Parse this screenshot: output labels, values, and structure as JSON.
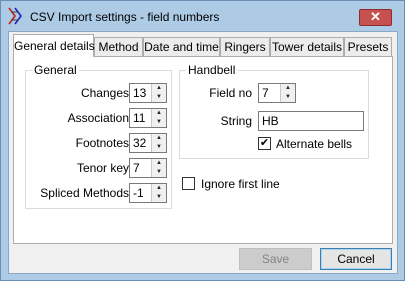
{
  "window": {
    "title": "CSV Import settings - field numbers",
    "close_glyph": "✕",
    "app_icon": "csv-app-icon",
    "accent": "#aecbe6"
  },
  "tabs": [
    {
      "label": "General details",
      "active": true
    },
    {
      "label": "Method"
    },
    {
      "label": "Date and time"
    },
    {
      "label": "Ringers"
    },
    {
      "label": "Tower details"
    },
    {
      "label": "Presets"
    }
  ],
  "general": {
    "title": "General",
    "changes": {
      "label": "Changes",
      "value": "13"
    },
    "association": {
      "label": "Association",
      "value": "11"
    },
    "footnotes": {
      "label": "Footnotes",
      "value": "32"
    },
    "tenor_key": {
      "label": "Tenor key",
      "value": "7"
    },
    "spliced_methods": {
      "label": "Spliced Methods",
      "value": "-1"
    }
  },
  "handbell": {
    "title": "Handbell",
    "field_no": {
      "label": "Field no",
      "value": "7"
    },
    "string": {
      "label": "String",
      "value": "HB"
    },
    "alternate_bells": {
      "label": "Alternate bells",
      "checked": true
    }
  },
  "ignore_first_line": {
    "label": "Ignore first line",
    "checked": false
  },
  "buttons": {
    "save": "Save",
    "cancel": "Cancel"
  },
  "glyphs": {
    "up": "▲",
    "down": "▼",
    "check": "✔"
  }
}
